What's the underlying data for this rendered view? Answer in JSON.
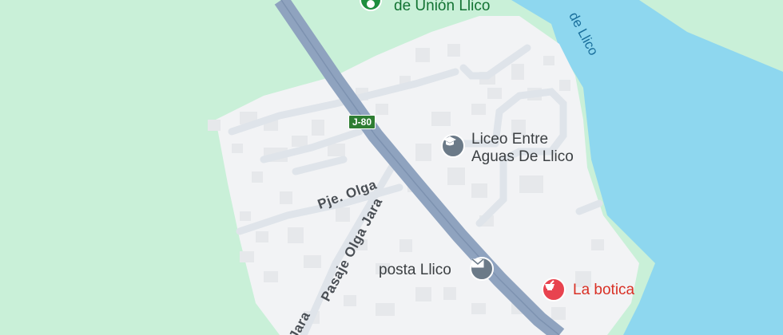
{
  "colors": {
    "land": "#c9f0d8",
    "town": "#f2f3f5",
    "water": "#8ed7ef",
    "highway": "#8fa3bf",
    "minor_road": "#dfe4ea",
    "building": "#e6e8eb",
    "poi_grey": "#6b7a88",
    "poi_red": "#e8434f",
    "poi_green": "#1e8e3e"
  },
  "pois": {
    "top_green": {
      "label": "de Unión Llico",
      "icon": "green-circle-pin-icon"
    },
    "school": {
      "label_line1": "Liceo Entre",
      "label_line2": "Aguas De Llico",
      "icon": "school-cap-icon"
    },
    "post": {
      "label": "posta Llico",
      "icon": "mail-envelope-icon"
    },
    "pharmacy": {
      "label": "La botica",
      "icon": "pharmacy-mortar-icon"
    }
  },
  "water": {
    "label": "de Llico"
  },
  "streets": {
    "pje_olga": "Pje. Olga",
    "pasaje_olga_jara": "Pasaje Olga Jara",
    "jara_cut": "Jara"
  },
  "route_shield": {
    "label": "J-80"
  }
}
